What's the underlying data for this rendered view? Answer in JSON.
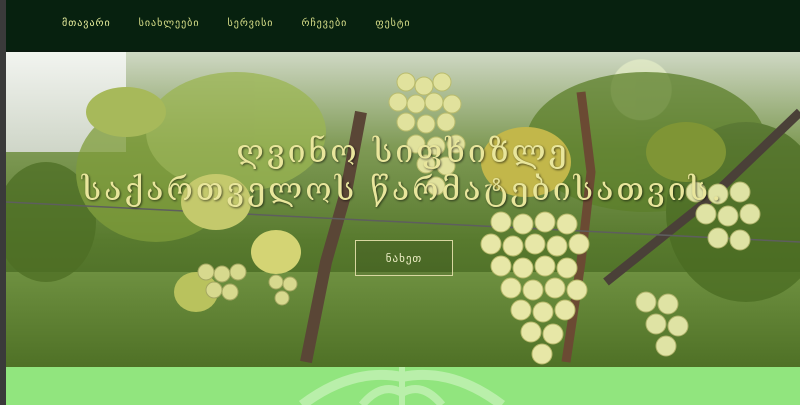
{
  "nav": {
    "items": [
      {
        "label": "მთავარი",
        "active": true
      },
      {
        "label": "სიახლეები",
        "active": false
      },
      {
        "label": "სერვისი",
        "active": false
      },
      {
        "label": "რჩევები",
        "active": false
      },
      {
        "label": "ფესტი",
        "active": false
      }
    ]
  },
  "hero": {
    "headline_line1": "ღვინო სიფხიზლე",
    "headline_line2": "საქართველოს წარმატებისათვის.",
    "button_label": "ნახეთ"
  },
  "colors": {
    "navbar_bg": "#07210f",
    "nav_text": "#d9e08a",
    "headline_text": "#e9e69c",
    "footer_strip": "#91e57e"
  }
}
